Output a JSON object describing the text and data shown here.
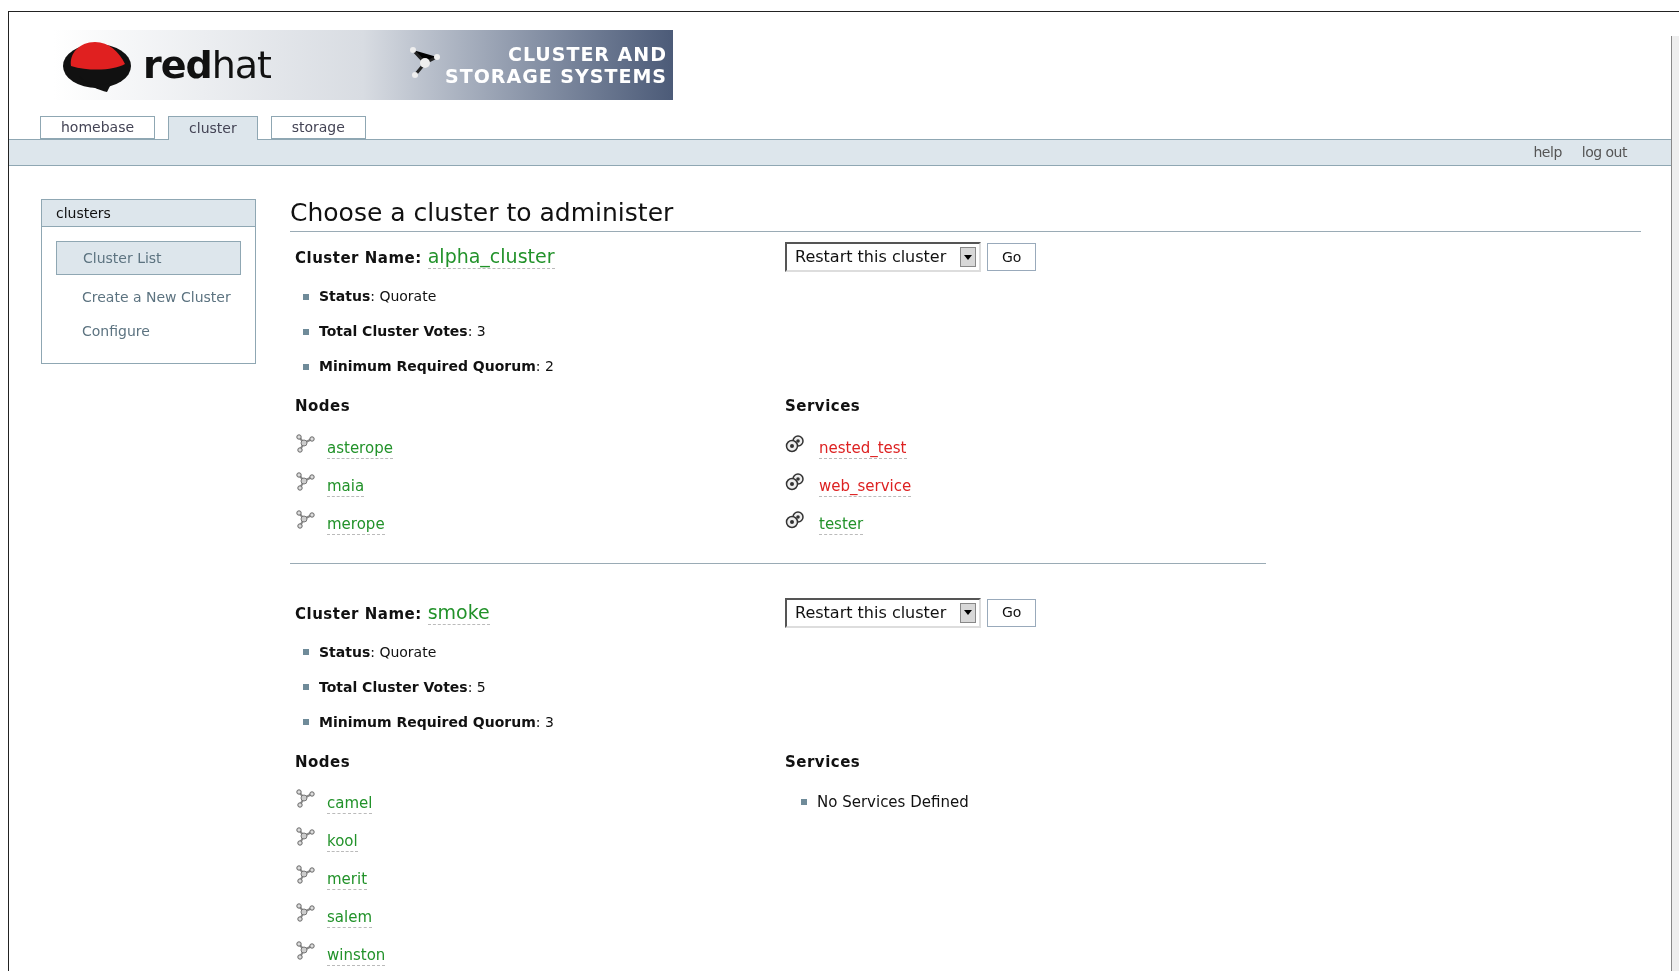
{
  "banner": {
    "logo_text": "**red**hat",
    "product_line_1": "CLUSTER AND",
    "product_line_2": "STORAGE SYSTEMS"
  },
  "tabs": [
    {
      "label": "homebase",
      "selected": false
    },
    {
      "label": "cluster",
      "selected": true
    },
    {
      "label": "storage",
      "selected": false
    }
  ],
  "top_links": [
    "help",
    "log out"
  ],
  "sidebar": {
    "title": "clusters",
    "items": [
      {
        "label": "Cluster List",
        "selected": true
      },
      {
        "label": "Create a New Cluster",
        "selected": false
      },
      {
        "label": "Configure",
        "selected": false
      }
    ]
  },
  "page_title": "Choose a cluster to administer",
  "clusters": [
    {
      "name_label": "Cluster Name:",
      "name": "alpha_cluster",
      "action": "Restart this cluster",
      "go": "Go",
      "stats": [
        "**Status**: Quorate",
        "**Total Cluster Votes**: 3",
        "**Minimum Required Quorum**: 2"
      ],
      "nodes_heading": "Nodes",
      "nodes": [
        "asterope",
        "maia",
        "merope"
      ],
      "services_heading": "Services",
      "services": [
        {
          "name": "nested_test",
          "color": "#dd2222"
        },
        {
          "name": "web_service",
          "color": "#dd2222"
        },
        {
          "name": "tester",
          "color": "#22922a"
        }
      ]
    },
    {
      "name_label": "Cluster Name:",
      "name": "smoke",
      "action": "Restart this cluster",
      "go": "Go",
      "stats": [
        "**Status**: Quorate",
        "**Total Cluster Votes**: 5",
        "**Minimum Required Quorum**: 3"
      ],
      "nodes_heading": "Nodes",
      "nodes": [
        "camel",
        "kool",
        "merit",
        "salem",
        "winston"
      ],
      "services_heading": "Services",
      "services_empty": "No Services Defined"
    }
  ]
}
